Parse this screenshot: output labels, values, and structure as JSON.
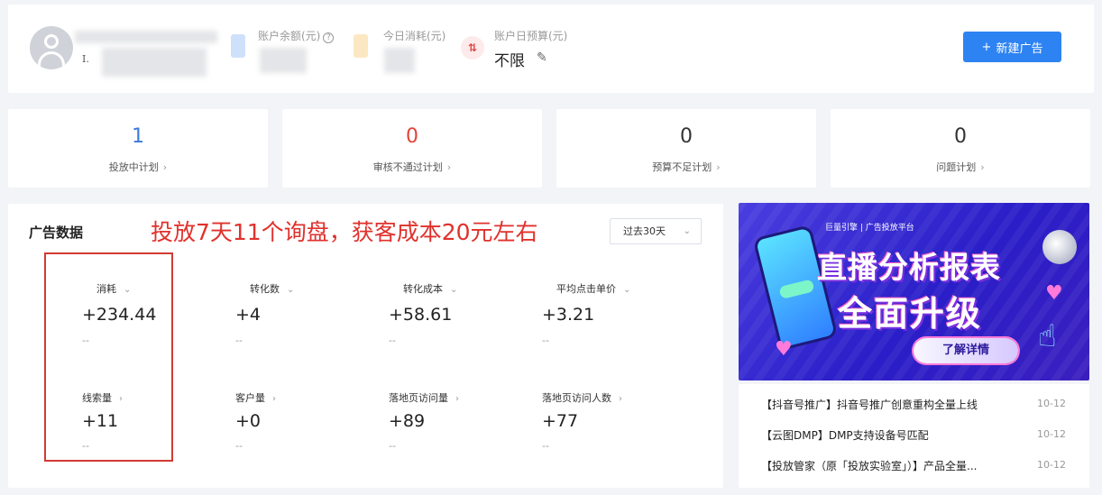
{
  "account": {
    "initial": "I.",
    "balance_label": "账户余额(元)",
    "today_spend_label": "今日消耗(元)",
    "daily_budget_label": "账户日预算(元)",
    "daily_budget_value": "不限",
    "new_ad_label": "新建广告"
  },
  "plans": [
    {
      "count": "1",
      "label": "投放中计划",
      "color": "#3a7bdc"
    },
    {
      "count": "0",
      "label": "审核不通过计划",
      "color": "#e0453a"
    },
    {
      "count": "0",
      "label": "预算不足计划",
      "color": "#333333"
    },
    {
      "count": "0",
      "label": "问题计划",
      "color": "#333333"
    }
  ],
  "ad_data": {
    "title": "广告数据",
    "annotation": "投放7天11个询盘，获客成本20元左右",
    "period": "过去30天",
    "metrics": [
      {
        "label": "消耗",
        "value": "+234.44",
        "change": "--",
        "toggle": "dropdown"
      },
      {
        "label": "转化数",
        "value": "+4",
        "change": "--",
        "toggle": "dropdown"
      },
      {
        "label": "转化成本",
        "value": "+58.61",
        "change": "--",
        "toggle": "dropdown"
      },
      {
        "label": "平均点击单价",
        "value": "+3.21",
        "change": "--",
        "toggle": "dropdown"
      },
      {
        "label": "线索量",
        "value": "+11",
        "change": "--",
        "toggle": "arrow"
      },
      {
        "label": "客户量",
        "value": "+0",
        "change": "--",
        "toggle": "arrow"
      },
      {
        "label": "落地页访问量",
        "value": "+89",
        "change": "--",
        "toggle": "arrow"
      },
      {
        "label": "落地页访问人数",
        "value": "+77",
        "change": "--",
        "toggle": "arrow"
      }
    ]
  },
  "banner": {
    "logo": "巨量引擎 | 广告投放平台",
    "line1": "直播分析报表",
    "line2": "全面升级",
    "cta": "了解详情"
  },
  "news": [
    {
      "title": "【抖音号推广】抖音号推广创意重构全量上线",
      "date": "10-12"
    },
    {
      "title": "【云图DMP】DMP支持设备号匹配",
      "date": "10-12"
    },
    {
      "title": "【投放管家（原「投放实验室」）】产品全量...",
      "date": "10-12"
    }
  ],
  "colors": {
    "primary": "#2e83f2",
    "annotation": "#e0312c",
    "highlight_box": "#d23a32"
  }
}
